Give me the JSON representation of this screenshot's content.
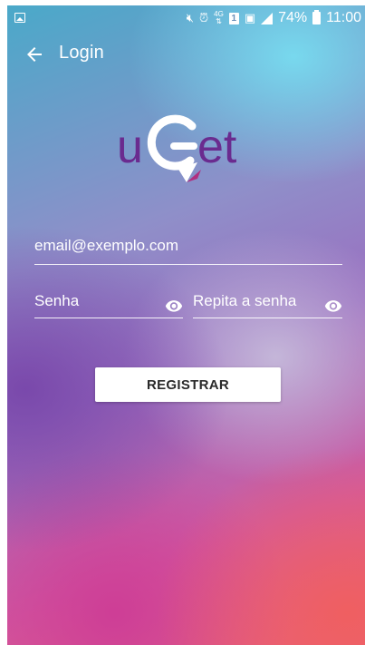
{
  "status_bar": {
    "network": "4G",
    "sim_slot": "1",
    "battery_percent": "74%",
    "time": "11:00"
  },
  "toolbar": {
    "back_icon": "arrow-left-icon",
    "title": "Login"
  },
  "logo": {
    "text_left": "u",
    "text_right": "et",
    "colors": {
      "purple": "#6a2b8f",
      "white": "#ffffff",
      "pink_tail": "#b03080"
    }
  },
  "form": {
    "email_placeholder": "email@exemplo.com",
    "password_placeholder": "Senha",
    "confirm_password_placeholder": "Repita a senha",
    "eye_icon": "eye-icon"
  },
  "actions": {
    "register_label": "REGISTRAR"
  }
}
